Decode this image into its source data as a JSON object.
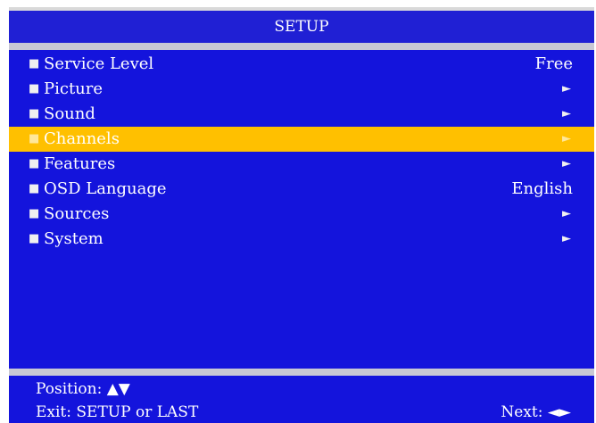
{
  "title": "SETUP",
  "menu": {
    "items": [
      {
        "label": "Service Level",
        "value": "Free",
        "arrow": "",
        "selected": false
      },
      {
        "label": "Picture",
        "value": "",
        "arrow": "►",
        "selected": false
      },
      {
        "label": "Sound",
        "value": "",
        "arrow": "►",
        "selected": false
      },
      {
        "label": "Channels",
        "value": "",
        "arrow": "►",
        "selected": true
      },
      {
        "label": "Features",
        "value": "",
        "arrow": "►",
        "selected": false
      },
      {
        "label": "OSD Language",
        "value": "English",
        "arrow": "",
        "selected": false
      },
      {
        "label": "Sources",
        "value": "",
        "arrow": "►",
        "selected": false
      },
      {
        "label": "System",
        "value": "",
        "arrow": "►",
        "selected": false
      }
    ],
    "bullet": "■"
  },
  "help": {
    "position": "Position: ▲▼",
    "exit": "Exit: SETUP or LAST",
    "next": "Next: ◄►"
  },
  "colors": {
    "panel_blue": "#1414dc",
    "selection_yellow": "#ffc000",
    "separator_gray": "#c8c8d4"
  }
}
